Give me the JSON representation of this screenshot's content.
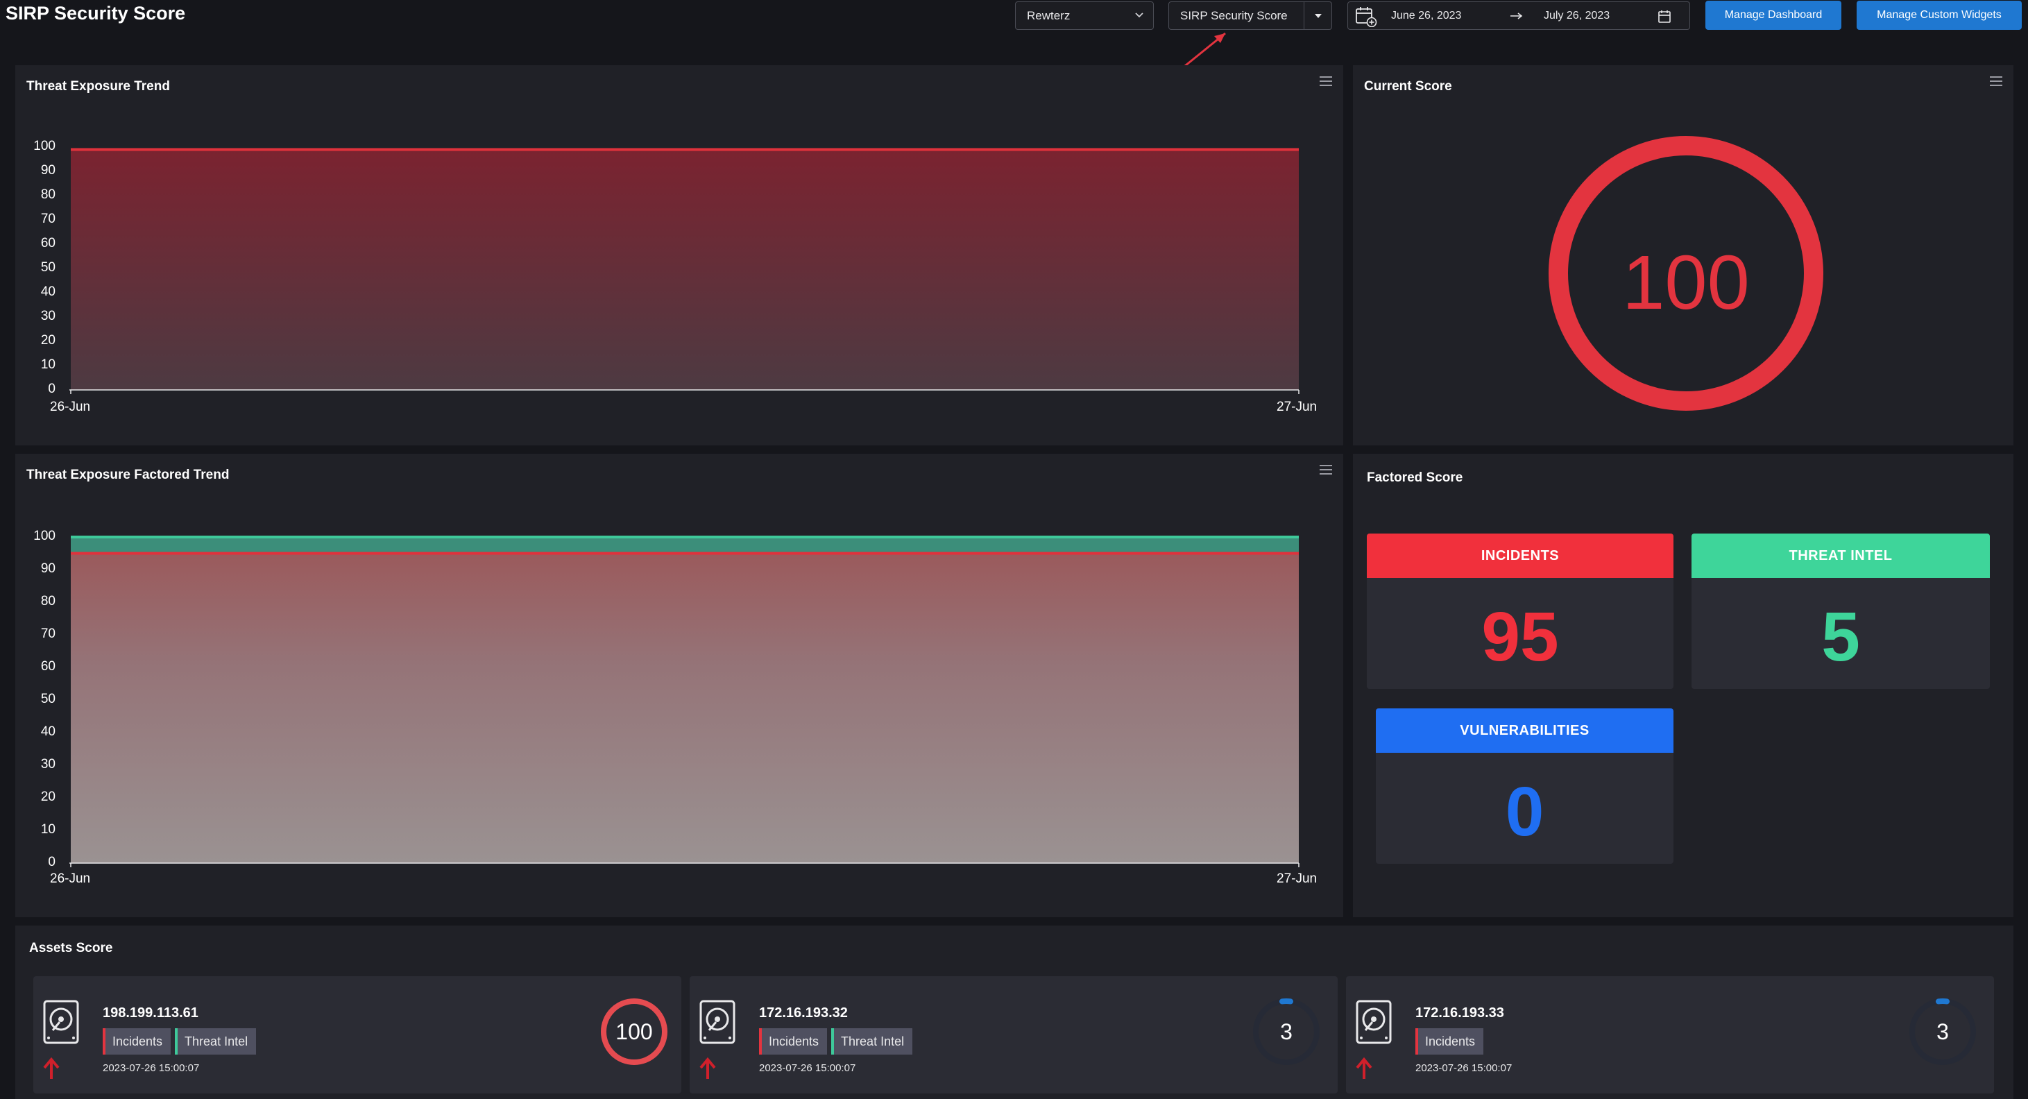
{
  "header": {
    "title": "SIRP Security Score",
    "tenant_select": "Rewterz",
    "dashboard_select": "SIRP Security Score",
    "date_from": "June 26, 2023",
    "date_to": "July 26, 2023",
    "manage_dashboard_label": "Manage Dashboard",
    "manage_widgets_label": "Manage Custom Widgets"
  },
  "threat_trend": {
    "title": "Threat Exposure Trend",
    "y_ticks": [
      "100",
      "90",
      "80",
      "70",
      "60",
      "50",
      "40",
      "30",
      "20",
      "10",
      "0"
    ],
    "x_ticks": [
      "26-Jun",
      "27-Jun"
    ]
  },
  "current_score": {
    "title": "Current Score",
    "value": "100"
  },
  "factored_trend": {
    "title": "Threat Exposure Factored Trend",
    "y_ticks": [
      "100",
      "90",
      "80",
      "70",
      "60",
      "50",
      "40",
      "30",
      "20",
      "10",
      "0"
    ],
    "x_ticks": [
      "26-Jun",
      "27-Jun"
    ]
  },
  "factored_score": {
    "title": "Factored Score",
    "incidents": {
      "label": "INCIDENTS",
      "value": "95",
      "color": "#f1303c"
    },
    "threat_intel": {
      "label": "THREAT INTEL",
      "value": "5",
      "color": "#3ed59a"
    },
    "vulnerabilities": {
      "label": "VULNERABILITIES",
      "value": "0",
      "color": "#1f6ef2"
    }
  },
  "assets": {
    "title": "Assets Score",
    "items": [
      {
        "ip": "198.199.113.61",
        "tags": [
          "Incidents",
          "Threat Intel"
        ],
        "timestamp": "2023-07-26 15:00:07",
        "score": "100"
      },
      {
        "ip": "172.16.193.32",
        "tags": [
          "Incidents",
          "Threat Intel"
        ],
        "timestamp": "2023-07-26 15:00:07",
        "score": "3"
      },
      {
        "ip": "172.16.193.33",
        "tags": [
          "Incidents"
        ],
        "timestamp": "2023-07-26 15:00:07",
        "score": "3"
      }
    ]
  },
  "chart_data": [
    {
      "type": "area",
      "title": "Threat Exposure Trend",
      "x": [
        "26-Jun",
        "27-Jun"
      ],
      "ylim": [
        0,
        100
      ],
      "series": [
        {
          "values": [
            99,
            99
          ],
          "color": "#e0323c"
        }
      ]
    },
    {
      "type": "area",
      "title": "Threat Exposure Factored Trend",
      "x": [
        "26-Jun",
        "27-Jun"
      ],
      "ylim": [
        0,
        100
      ],
      "series": [
        {
          "name": "Incidents",
          "values": [
            95,
            95
          ],
          "color": "#e0323c"
        },
        {
          "name": "Threat Intel",
          "values": [
            5,
            5
          ],
          "color": "#3ec99a"
        }
      ]
    }
  ]
}
